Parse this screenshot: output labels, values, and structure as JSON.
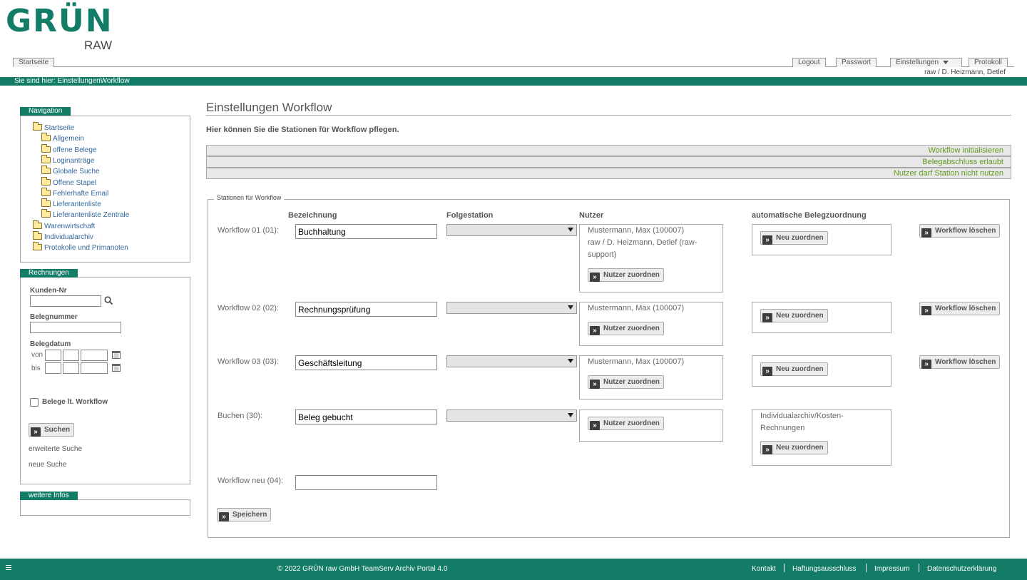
{
  "brand": {
    "name": "GRÜN",
    "sub": "RAW"
  },
  "topnav": {
    "home": "Startseite",
    "logout": "Logout",
    "password": "Passwort",
    "settings": "Einstellungen",
    "protocol": "Protokoll",
    "user": "raw / D. Heizmann, Detlef"
  },
  "breadcrumb": "Sie sind hier: EinstellungenWorkflow",
  "navigation": {
    "title": "Navigation",
    "items": [
      "Startseite",
      "Allgemein",
      "offene Belege",
      "Loginanträge",
      "Globale Suche",
      "Offene Stapel",
      "Fehlerhafte Email",
      "Lieferantenliste",
      "Lieferantenliste Zentrale",
      "Warenwirtschaft",
      "Individualarchiv",
      "Protokolle und Primanoten"
    ]
  },
  "invoices": {
    "title": "Rechnungen",
    "customer_no": "Kunden-Nr",
    "voucher_no": "Belegnummer",
    "voucher_date": "Belegdatum",
    "from": "von",
    "to": "bis",
    "workflow_checkbox": "Belege lt. Workflow",
    "search_button": "Suchen",
    "extended_search": "erweiterte Suche",
    "new_search": "neue Suche"
  },
  "more_info": {
    "title": "weitere Infos"
  },
  "main": {
    "title": "Einstellungen Workflow",
    "intro": "Hier können Sie die Stationen für Workflow pflegen.",
    "status_rows": [
      "Workflow initialisieren",
      "Belegabschluss erlaubt",
      "Nutzer darf Station nicht nutzen"
    ],
    "legend": "Stationen für Workflow",
    "columns": {
      "name": "Bezeichnung",
      "next": "Folgestation",
      "users": "Nutzer",
      "auto": "automatische Belegzuordnung"
    },
    "workflows": [
      {
        "label": "Workflow 01 (01):",
        "name": "Buchhaltung",
        "users": [
          "Mustermann, Max (100007)",
          "raw / D. Heizmann, Detlef (raw-",
          "support)"
        ],
        "assign_users": "Nutzer zuordnen",
        "auto_text": [],
        "assign_new": "Neu zuordnen",
        "delete": "Workflow löschen"
      },
      {
        "label": "Workflow 02 (02):",
        "name": "Rechnungsprüfung",
        "users": [
          "Mustermann, Max (100007)"
        ],
        "assign_users": "Nutzer zuordnen",
        "auto_text": [],
        "assign_new": "Neu zuordnen",
        "delete": "Workflow löschen"
      },
      {
        "label": "Workflow 03 (03):",
        "name": "Geschäftsleitung",
        "users": [
          "Mustermann, Max (100007)"
        ],
        "assign_users": "Nutzer zuordnen",
        "auto_text": [],
        "assign_new": "Neu zuordnen",
        "delete": "Workflow löschen"
      },
      {
        "label": "Buchen (30):",
        "name": "Beleg gebucht",
        "users": [],
        "assign_users": "Nutzer zuordnen",
        "auto_text": [
          "Individualarchiv/Kosten-",
          "Rechnungen"
        ],
        "assign_new": "Neu zuordnen",
        "delete": ""
      }
    ],
    "new_workflow_label": "Workflow neu (04):",
    "new_workflow_value": "",
    "save_button": "Speichern"
  },
  "footer": {
    "copyright": "© 2022 GRÜN raw GmbH TeamServ Archiv Portal 4.0",
    "links": [
      "Kontakt",
      "Haftungsausschluss",
      "Impressum",
      "Datenschutzerklärung"
    ]
  },
  "colors": {
    "brand_green": "#137c66",
    "status_green": "#5e9a1e"
  },
  "icons": [
    "folder-icon",
    "search-icon",
    "calendar-icon",
    "double-chevron-right-icon",
    "chevron-down-icon",
    "menu-icon"
  ]
}
